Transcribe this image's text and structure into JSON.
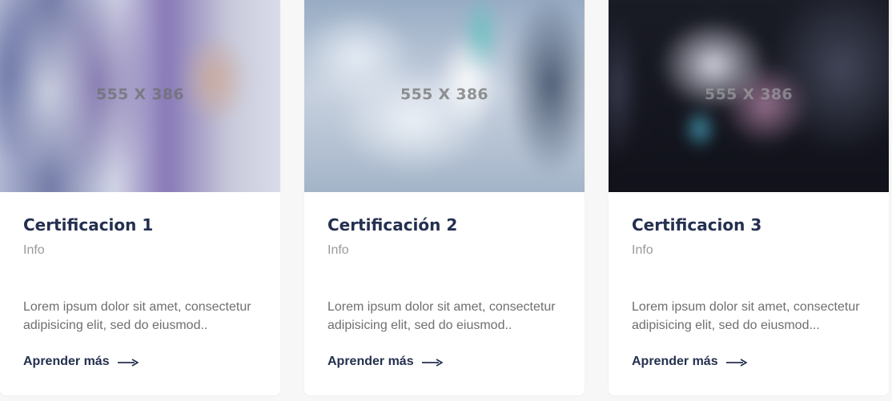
{
  "cards": [
    {
      "image_label": "555 X 386",
      "title": "Certificacion 1",
      "subtitle": "Info",
      "description": "Lorem ipsum dolor sit amet, consectetur adipisicing elit, sed do eiusmod..",
      "link_label": "Aprender más",
      "link_icon": "arrow-right-icon"
    },
    {
      "image_label": "555 X 386",
      "title": "Certificación 2",
      "subtitle": "Info",
      "description": "Lorem ipsum dolor sit amet, consectetur adipisicing elit, sed do eiusmod..",
      "link_label": "Aprender más",
      "link_icon": "arrow-right-icon"
    },
    {
      "image_label": "555 X 386",
      "title": "Certificacion 3",
      "subtitle": "Info",
      "description": "Lorem ipsum dolor sit amet, consectetur adipisicing elit, sed do eiusmod...",
      "link_label": "Aprender más",
      "link_icon": "arrow-right-icon"
    }
  ],
  "colors": {
    "page_background": "#f7f7f7",
    "card_background": "#ffffff",
    "title": "#24304f",
    "subtitle": "#9a9a9a",
    "description": "#6f6f6f",
    "link": "#24304f"
  }
}
